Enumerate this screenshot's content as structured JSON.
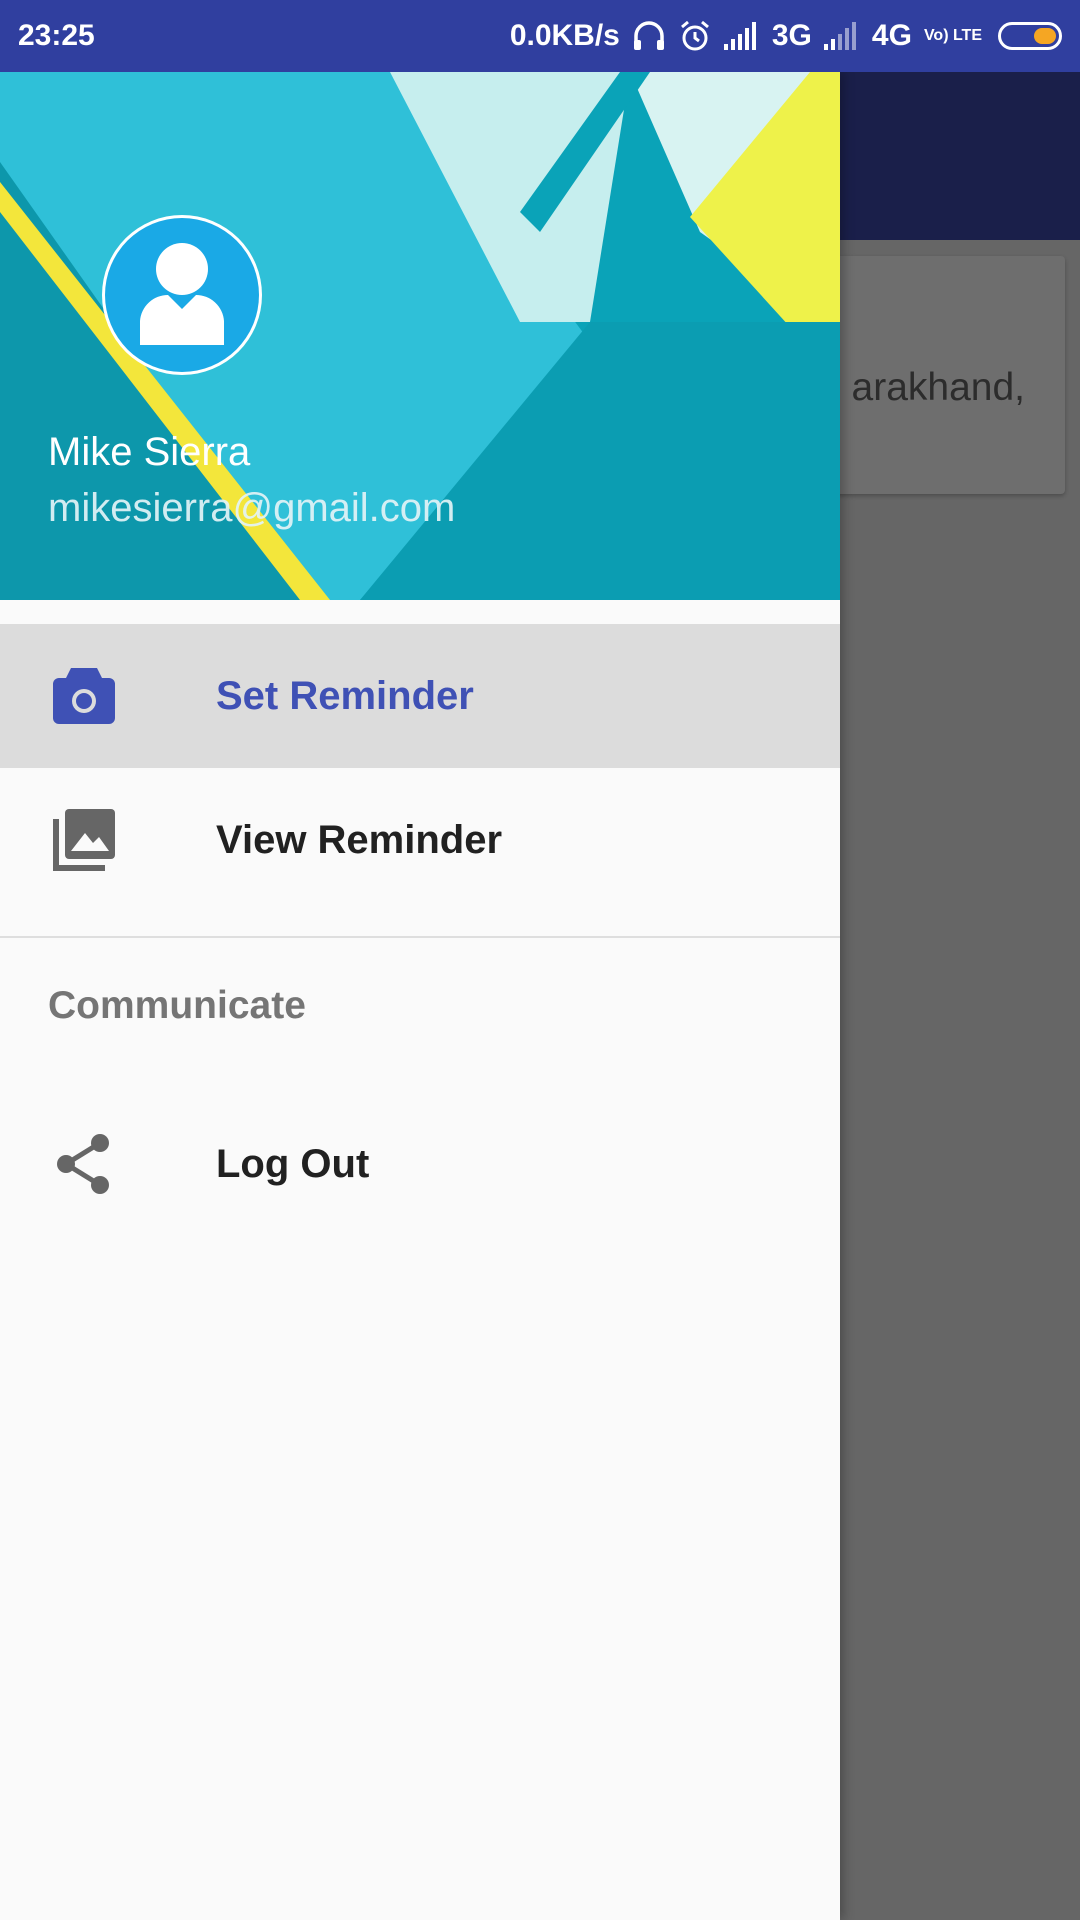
{
  "status_bar": {
    "time": "23:25",
    "speed": "0.0KB/s",
    "network1": "3G",
    "network2": "4G",
    "volte": "Vo) LTE",
    "battery_color": "#f5a623"
  },
  "background_app": {
    "card_text": "arakhand,"
  },
  "drawer": {
    "user_name": "Mike Sierra",
    "user_email": "mikesierra@gmail.com",
    "items": [
      {
        "label": "Set Reminder",
        "icon": "camera-icon",
        "active": true
      },
      {
        "label": "View Reminder",
        "icon": "photo-library-icon",
        "active": false
      }
    ],
    "section_title": "Communicate",
    "section_items": [
      {
        "label": "Log Out",
        "icon": "share-icon"
      }
    ]
  },
  "colors": {
    "primary": "#303f9f",
    "accent": "#3f51b5",
    "header_teal": "#0aa3b8"
  }
}
